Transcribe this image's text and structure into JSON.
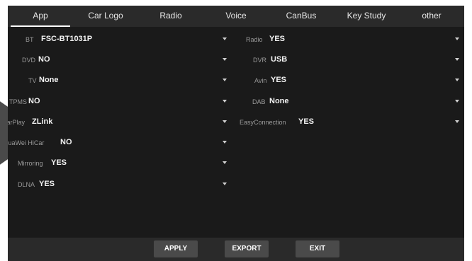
{
  "tabs": [
    {
      "label": "App",
      "active": true
    },
    {
      "label": "Car Logo",
      "active": false
    },
    {
      "label": "Radio",
      "active": false
    },
    {
      "label": "Voice",
      "active": false
    },
    {
      "label": "CanBus",
      "active": false
    },
    {
      "label": "Key Study",
      "active": false
    },
    {
      "label": "other",
      "active": false
    }
  ],
  "left_settings": [
    {
      "label": "BT",
      "value": "FSC-BT1031P"
    },
    {
      "label": "DVD",
      "value": "NO"
    },
    {
      "label": "TV",
      "value": "None"
    },
    {
      "label": "TPMS",
      "value": "NO"
    },
    {
      "label": "CarPlay",
      "value": "ZLink"
    },
    {
      "label": "HuaWei HiCar",
      "value": "NO"
    },
    {
      "label": "Mirroring",
      "value": "YES"
    },
    {
      "label": "DLNA",
      "value": "YES"
    }
  ],
  "right_settings": [
    {
      "label": "Radio",
      "value": "YES"
    },
    {
      "label": "DVR",
      "value": "USB"
    },
    {
      "label": "Avin",
      "value": "YES"
    },
    {
      "label": "DAB",
      "value": "None"
    },
    {
      "label": "EasyConnection",
      "value": "YES"
    }
  ],
  "buttons": {
    "apply": "APPLY",
    "export": "EXPORT",
    "exit": "EXIT"
  },
  "icons": {
    "dropdown": "chevron-down-icon"
  },
  "colors": {
    "screen_bg": "#1a1a1a",
    "bar_bg": "#2a2a2a",
    "button_bg": "#4a4a4a"
  }
}
